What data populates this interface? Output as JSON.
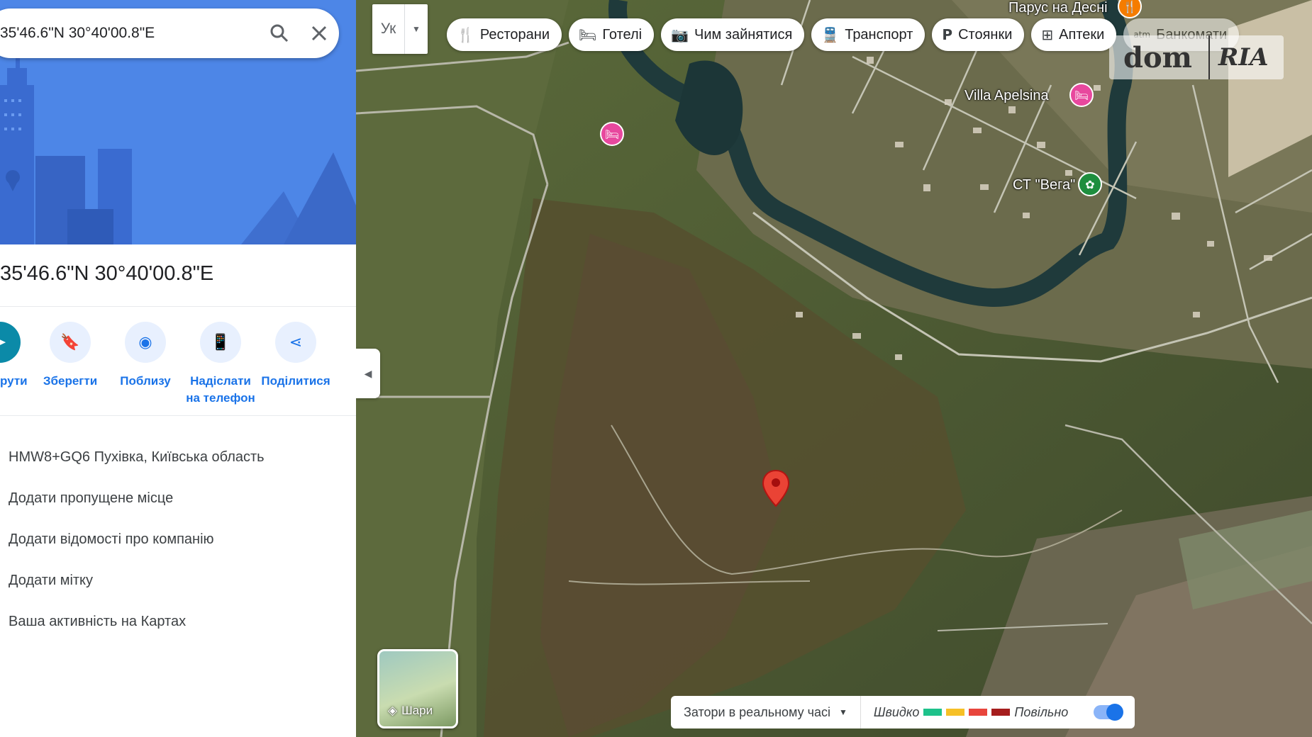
{
  "search": {
    "query": "35'46.6\"N 30°40'00.8\"E"
  },
  "place": {
    "title": "35'46.6\"N 30°40'00.8\"E"
  },
  "actions": [
    {
      "label": "рути",
      "icon": "directions-icon"
    },
    {
      "label": "Зберегти",
      "icon": "bookmark-icon"
    },
    {
      "label": "Поблизу",
      "icon": "nearby-icon"
    },
    {
      "label": "Надіслати на телефон",
      "icon": "send-to-phone-icon"
    },
    {
      "label": "Поділитися",
      "icon": "share-icon"
    }
  ],
  "details": [
    "HMW8+GQ6 Пухівка, Київська область",
    "Додати пропущене місце",
    "Додати відомості про компанію",
    "Додати мітку",
    "Ваша активність на Картах"
  ],
  "map": {
    "language_button": "Ук",
    "chips": [
      {
        "label": "Ресторани",
        "icon": "restaurant-icon"
      },
      {
        "label": "Готелі",
        "icon": "hotel-icon"
      },
      {
        "label": "Чим зайнятися",
        "icon": "camera-icon"
      },
      {
        "label": "Транспорт",
        "icon": "transit-icon"
      },
      {
        "label": "Стоянки",
        "icon": "parking-icon"
      },
      {
        "label": "Аптеки",
        "icon": "pharmacy-icon"
      },
      {
        "label": "Банкомати",
        "icon": "atm-icon"
      }
    ],
    "pois": [
      {
        "label": "Парус на Десні",
        "icon": "restaurant-icon",
        "color": "#f57c00"
      },
      {
        "label": "Villa Apelsina",
        "icon": "hotel-icon",
        "color": "#e8489e"
      },
      {
        "label": "СТ \"Вега\"",
        "icon": "park-icon",
        "color": "#1e8e3e"
      },
      {
        "label": "",
        "icon": "hotel-icon",
        "color": "#e8489e"
      }
    ],
    "watermark": {
      "left": "dom",
      "right": "RIA"
    },
    "layers_label": "Шари",
    "traffic": {
      "label": "Затори в реальному часі",
      "fast": "Швидко",
      "slow": "Повільно",
      "colors": [
        "#1ec28b",
        "#f6c026",
        "#e8453c",
        "#a51d1d"
      ]
    },
    "marker_color": "#ea4335"
  }
}
